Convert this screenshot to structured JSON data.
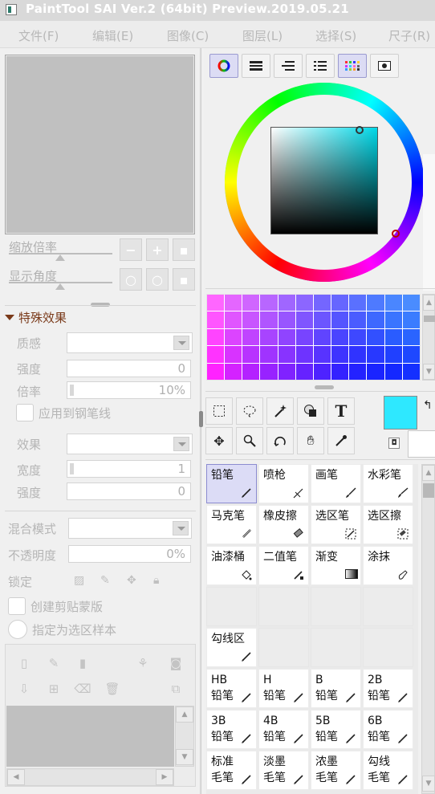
{
  "titlebar": {
    "title": "PaintTool SAI Ver.2 (64bit) Preview.2019.05.21"
  },
  "menu": [
    {
      "label": "文件(F)"
    },
    {
      "label": "编辑(E)"
    },
    {
      "label": "图像(C)"
    },
    {
      "label": "图层(L)"
    },
    {
      "label": "选择(S)"
    },
    {
      "label": "尺子(R)"
    }
  ],
  "navigator": {
    "zoom_label": "缩放倍率",
    "angle_label": "显示角度",
    "zoom_buttons": [
      "−",
      "+",
      "▪"
    ],
    "angle_buttons": [
      "○",
      "○",
      "▪"
    ]
  },
  "effects": {
    "title": "特殊效果",
    "texture_label": "质感",
    "intensity_label": "强度",
    "intensity_value": "0",
    "scale_label": "倍率",
    "scale_value": "10%",
    "apply_pen_label": "应用到钢笔线",
    "effect_label": "效果",
    "width_label": "宽度",
    "width_value": "1",
    "strength_label": "强度",
    "strength_value": "0"
  },
  "layer": {
    "blend_mode_label": "混合模式",
    "opacity_label": "不透明度",
    "opacity_value": "0%",
    "lock_label": "锁定",
    "clipping_label": "创建剪贴蒙版",
    "selection_source_label": "指定为选区样本"
  },
  "colors": {
    "current": "#2ee8ff",
    "secondary": "#ffffff",
    "accent": "#9a9ad0",
    "swatches": [
      "#ff66ff",
      "#e466ff",
      "#d066ff",
      "#b866ff",
      "#a066ff",
      "#8c66ff",
      "#7466ff",
      "#6666ff",
      "#5a70ff",
      "#4e7aff",
      "#4a86ff",
      "#4a8cff",
      "#ff55ff",
      "#e055ff",
      "#c855ff",
      "#b055ff",
      "#9855ff",
      "#8055ff",
      "#6c55ff",
      "#5555ff",
      "#4a5cff",
      "#3e68ff",
      "#3a74ff",
      "#3a7cff",
      "#ff44ff",
      "#dc44ff",
      "#c044ff",
      "#a844ff",
      "#9044ff",
      "#7844ff",
      "#6044ff",
      "#4a44ff",
      "#3e48ff",
      "#3250ff",
      "#2a5cff",
      "#2a64ff",
      "#ff33ff",
      "#d833ff",
      "#b833ff",
      "#a033ff",
      "#8833ff",
      "#6e33ff",
      "#5833ff",
      "#3e33ff",
      "#3033ff",
      "#2838ff",
      "#2040ff",
      "#1e48ff",
      "#ff22ff",
      "#d422ff",
      "#b422ff",
      "#9822ff",
      "#8022ff",
      "#6622ff",
      "#4e22ff",
      "#3422ff",
      "#2422ff",
      "#1a24ff",
      "#1428ff",
      "#1430ff"
    ]
  },
  "text_tool": "T",
  "brushes": [
    {
      "label": "铅笔",
      "icon": "pencil-icon",
      "selected": true
    },
    {
      "label": "喷枪",
      "icon": "airbrush-icon"
    },
    {
      "label": "画笔",
      "icon": "brush-icon"
    },
    {
      "label": "水彩笔",
      "icon": "watercolor-icon"
    },
    {
      "label": "马克笔",
      "icon": "marker-icon"
    },
    {
      "label": "橡皮擦",
      "icon": "eraser-icon"
    },
    {
      "label": "选区笔",
      "icon": "select-pen-icon"
    },
    {
      "label": "选区擦",
      "icon": "select-eraser-icon"
    },
    {
      "label": "油漆桶",
      "icon": "bucket-icon"
    },
    {
      "label": "二值笔",
      "icon": "binary-pen-icon"
    },
    {
      "label": "渐变",
      "icon": "gradient-icon"
    },
    {
      "label": "涂抹",
      "icon": "smudge-icon"
    },
    {
      "label": "",
      "empty": true
    },
    {
      "label": "",
      "empty": true
    },
    {
      "label": "",
      "empty": true
    },
    {
      "label": "",
      "empty": true
    },
    {
      "label": "勾线区",
      "icon": "pencil-icon"
    },
    {
      "label": "",
      "empty": true
    },
    {
      "label": "",
      "empty": true
    },
    {
      "label": "",
      "empty": true
    },
    {
      "label": "HB\n铅笔",
      "icon": "pencil-icon"
    },
    {
      "label": "H\n铅笔",
      "icon": "pencil-icon"
    },
    {
      "label": "B\n铅笔",
      "icon": "pencil-icon"
    },
    {
      "label": "2B\n铅笔",
      "icon": "pencil-icon"
    },
    {
      "label": "3B\n铅笔",
      "icon": "pencil-icon"
    },
    {
      "label": "4B\n铅笔",
      "icon": "pencil-icon"
    },
    {
      "label": "5B\n铅笔",
      "icon": "pencil-icon"
    },
    {
      "label": "6B\n铅笔",
      "icon": "pencil-icon"
    },
    {
      "label": "标准\n毛笔",
      "icon": "pencil-icon"
    },
    {
      "label": "淡墨\n毛笔",
      "icon": "pencil-icon"
    },
    {
      "label": "浓墨\n毛笔",
      "icon": "pencil-icon"
    },
    {
      "label": "勾线\n毛笔",
      "icon": "pencil-icon"
    }
  ]
}
